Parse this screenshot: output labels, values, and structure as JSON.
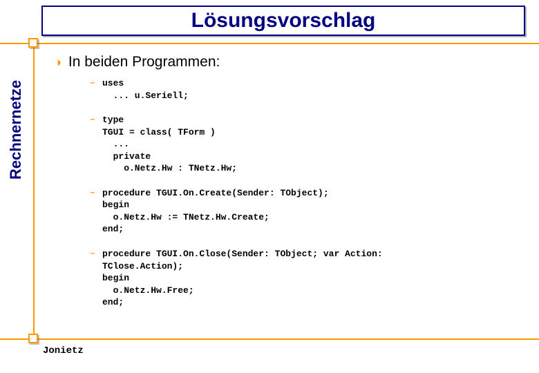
{
  "title": "Lösungsvorschlag",
  "sidebar": "Rechnernetze",
  "bullet": "In beiden Programmen:",
  "items": [
    "uses\n  ... u.Seriell;",
    "type\nTGUI = class( TForm )\n  ...\n  private\n    o.Netz.Hw : TNetz.Hw;",
    "procedure TGUI.On.Create(Sender: TObject);\nbegin\n  o.Netz.Hw := TNetz.Hw.Create;\nend;",
    "procedure TGUI.On.Close(Sender: TObject; var Action:\nTClose.Action);\nbegin\n  o.Netz.Hw.Free;\nend;"
  ],
  "footer": "Jonietz",
  "colors": {
    "accent": "#FF9900",
    "primary": "#000080"
  }
}
